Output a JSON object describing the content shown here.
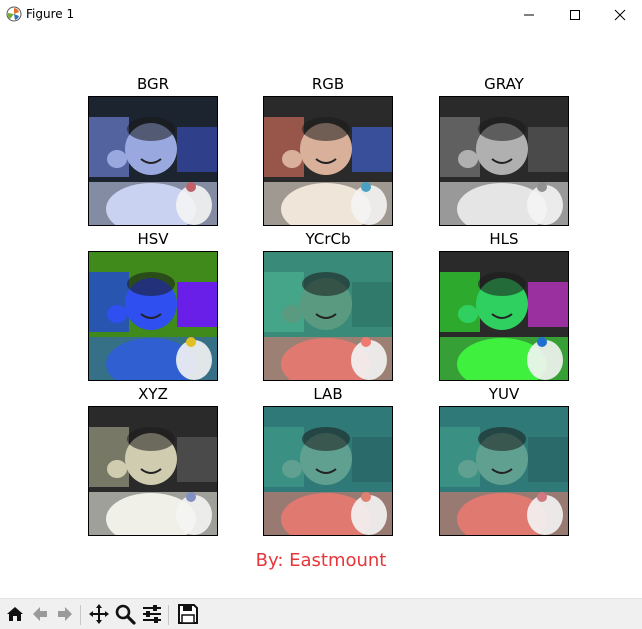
{
  "window": {
    "title": "Figure 1",
    "controls": [
      "minimize",
      "maximize",
      "close"
    ]
  },
  "figure": {
    "panels": [
      {
        "title": "BGR",
        "tint": "bgr"
      },
      {
        "title": "RGB",
        "tint": "rgb"
      },
      {
        "title": "GRAY",
        "tint": "gray"
      },
      {
        "title": "HSV",
        "tint": "hsv"
      },
      {
        "title": "YCrCb",
        "tint": "ycrcb"
      },
      {
        "title": "HLS",
        "tint": "hls"
      },
      {
        "title": "XYZ",
        "tint": "xyz"
      },
      {
        "title": "LAB",
        "tint": "lab"
      },
      {
        "title": "YUV",
        "tint": "yuv"
      }
    ],
    "footer_text": "By: Eastmount",
    "footer_color": "#e8353a"
  },
  "toolbar": {
    "tools": [
      "home-icon",
      "back-icon",
      "forward-icon",
      "pan-icon",
      "zoom-icon",
      "configure-subplots-icon",
      "save-icon"
    ]
  }
}
